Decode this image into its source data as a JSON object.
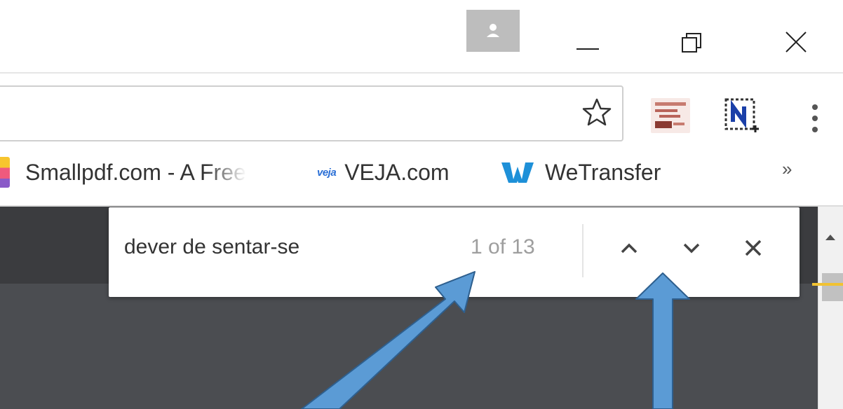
{
  "bookmarks": {
    "items": [
      {
        "label": "Smallpdf.com - A Free"
      },
      {
        "label": "VEJA.com",
        "icon_text": "veja"
      },
      {
        "label": "WeTransfer"
      }
    ],
    "overflow": "»"
  },
  "find_bar": {
    "query": "dever de sentar-se",
    "count": "1 of 13"
  },
  "colors": {
    "page_dark": "#4b4d51",
    "arrow_fill": "#5b9bd5",
    "arrow_stroke": "#2e5f8e",
    "wetransfer": "#1e90d8"
  },
  "icons": {
    "profile": "person-icon",
    "minimize": "minimize-icon",
    "restore": "restore-icon",
    "close": "close-icon",
    "star": "star-icon",
    "menu": "vertical-dots-icon",
    "find_prev": "chevron-up-icon",
    "find_next": "chevron-down-icon",
    "find_close": "close-icon"
  }
}
